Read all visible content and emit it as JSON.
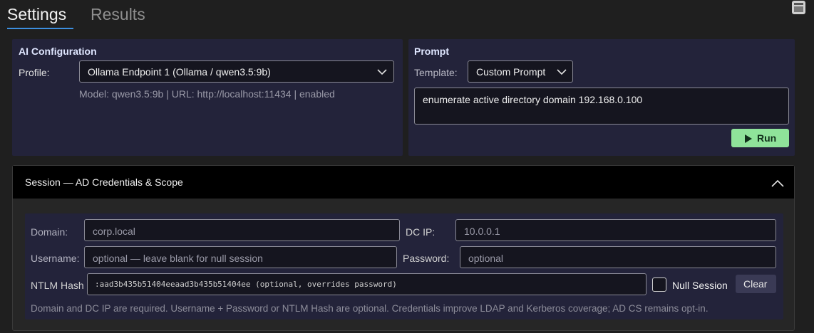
{
  "tabs": {
    "settings": "Settings",
    "results": "Results"
  },
  "ai_config": {
    "title": "AI Configuration",
    "profile_label": "Profile:",
    "profile_value": "Ollama Endpoint 1 (Ollama / qwen3.5:9b)",
    "model_info": "Model: qwen3.5:9b | URL: http://localhost:11434 | enabled"
  },
  "prompt": {
    "title": "Prompt",
    "template_label": "Template:",
    "template_value": "Custom Prompt",
    "text": "enumerate active directory domain 192.168.0.100",
    "run_label": "Run"
  },
  "session": {
    "title": "Session — AD Credentials & Scope",
    "domain_label": "Domain:",
    "domain_placeholder": "corp.local",
    "dcip_label": "DC IP:",
    "dcip_placeholder": "10.0.0.1",
    "username_label": "Username:",
    "username_placeholder": "optional — leave blank for null session",
    "password_label": "Password:",
    "password_placeholder": "optional",
    "ntlm_label": "NTLM Hash",
    "ntlm_placeholder": ":aad3b435b51404eeaad3b435b51404ee  (optional, overrides password)",
    "null_session_label": "Null Session",
    "clear_label": "Clear",
    "hint": "Domain and DC IP are required. Username + Password or NTLM Hash are optional. Credentials improve LDAP and Kerberos coverage; AD CS remains opt-in."
  },
  "colors": {
    "accent": "#3d8fe0",
    "run_button": "#8fe39a",
    "panel": "#23233a",
    "background": "#1f1f1f"
  }
}
